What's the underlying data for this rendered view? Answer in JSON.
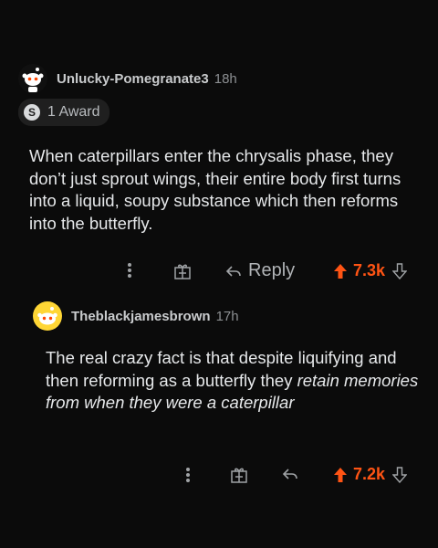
{
  "comments": [
    {
      "username": "Unlucky-Pomegranate3",
      "time": "18h",
      "award": {
        "icon": "S",
        "label": "1 Award"
      },
      "body": "When caterpillars enter the chrysalis phase, they don’t just sprout wings, their entire body first turns into a liquid, soupy substance which then reforms into the butterfly.",
      "actions": {
        "reply_label": "Reply",
        "score": "7.3k"
      }
    },
    {
      "username": "Theblackjamesbrown",
      "time": "17h",
      "body_plain": "The real crazy fact is that despite liquifying and then reforming as a butterfly they",
      "body_italic": "retain memories from when they were a caterpillar",
      "actions": {
        "score": "7.2k"
      }
    }
  ],
  "colors": {
    "upvote": "#ff5414",
    "background": "#0b0b0b",
    "text": "#e6e8ea"
  },
  "icons": [
    "more-icon",
    "gift-icon",
    "reply-icon",
    "upvote-icon",
    "downvote-icon"
  ]
}
